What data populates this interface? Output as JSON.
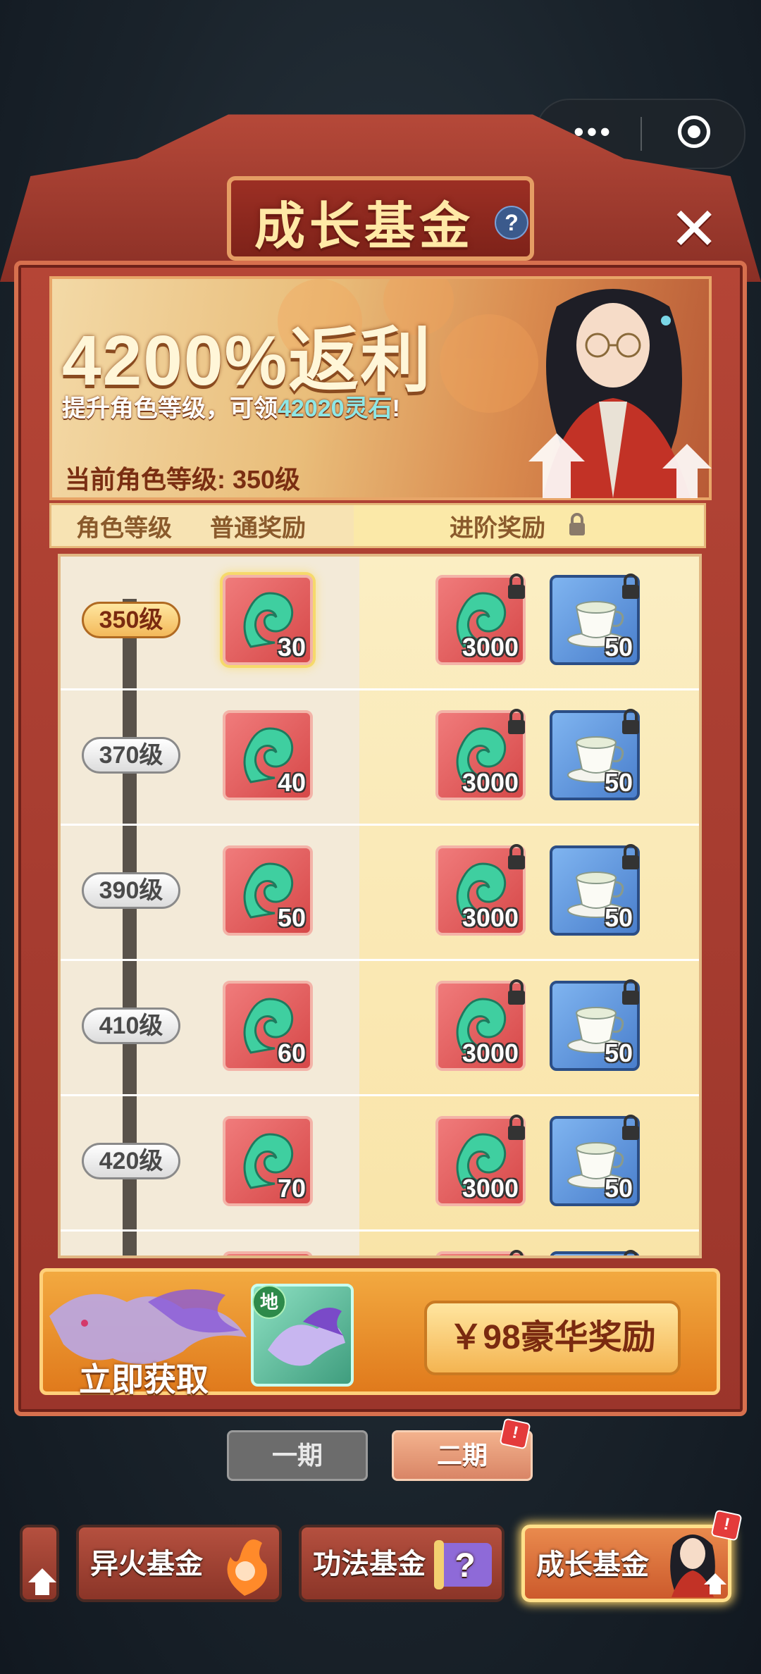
{
  "header": {
    "title": "成长基金",
    "help_icon": "?",
    "close_icon": "✕"
  },
  "capsule": {
    "more": "•••"
  },
  "banner": {
    "headline": "4200%返利",
    "subline_prefix": "提升角色等级，可领",
    "subline_highlight": "42020灵石",
    "subline_suffix": "!",
    "current_level": "当前角色等级: 350级"
  },
  "table_header": {
    "col_level": "角色等级",
    "col_normal": "普通奖励",
    "col_advanced": "进阶奖励"
  },
  "rows": [
    {
      "level": "350级",
      "active": true,
      "normal_qty": "30",
      "adv_qty_1": "3000",
      "adv_qty_2": "50"
    },
    {
      "level": "370级",
      "active": false,
      "normal_qty": "40",
      "adv_qty_1": "3000",
      "adv_qty_2": "50"
    },
    {
      "level": "390级",
      "active": false,
      "normal_qty": "50",
      "adv_qty_1": "3000",
      "adv_qty_2": "50"
    },
    {
      "level": "410级",
      "active": false,
      "normal_qty": "60",
      "adv_qty_1": "3000",
      "adv_qty_2": "50"
    },
    {
      "level": "420级",
      "active": false,
      "normal_qty": "70",
      "adv_qty_1": "3000",
      "adv_qty_2": "50"
    }
  ],
  "purchase": {
    "get_now": "立即获取",
    "card_badge": "地",
    "buy_label": "￥98豪华奖励"
  },
  "phases": [
    {
      "label": "一期",
      "selected": false
    },
    {
      "label": "二期",
      "selected": true,
      "badge": "!"
    }
  ],
  "fund_tabs": [
    {
      "label": "异火基金",
      "selected": false
    },
    {
      "label": "功法基金",
      "selected": false
    },
    {
      "label": "成长基金",
      "selected": true,
      "badge": "!"
    }
  ],
  "colors": {
    "frame_red": "#b54536",
    "highlight_cyan": "#8ee7e6",
    "gold_text": "#ffe9a6"
  }
}
